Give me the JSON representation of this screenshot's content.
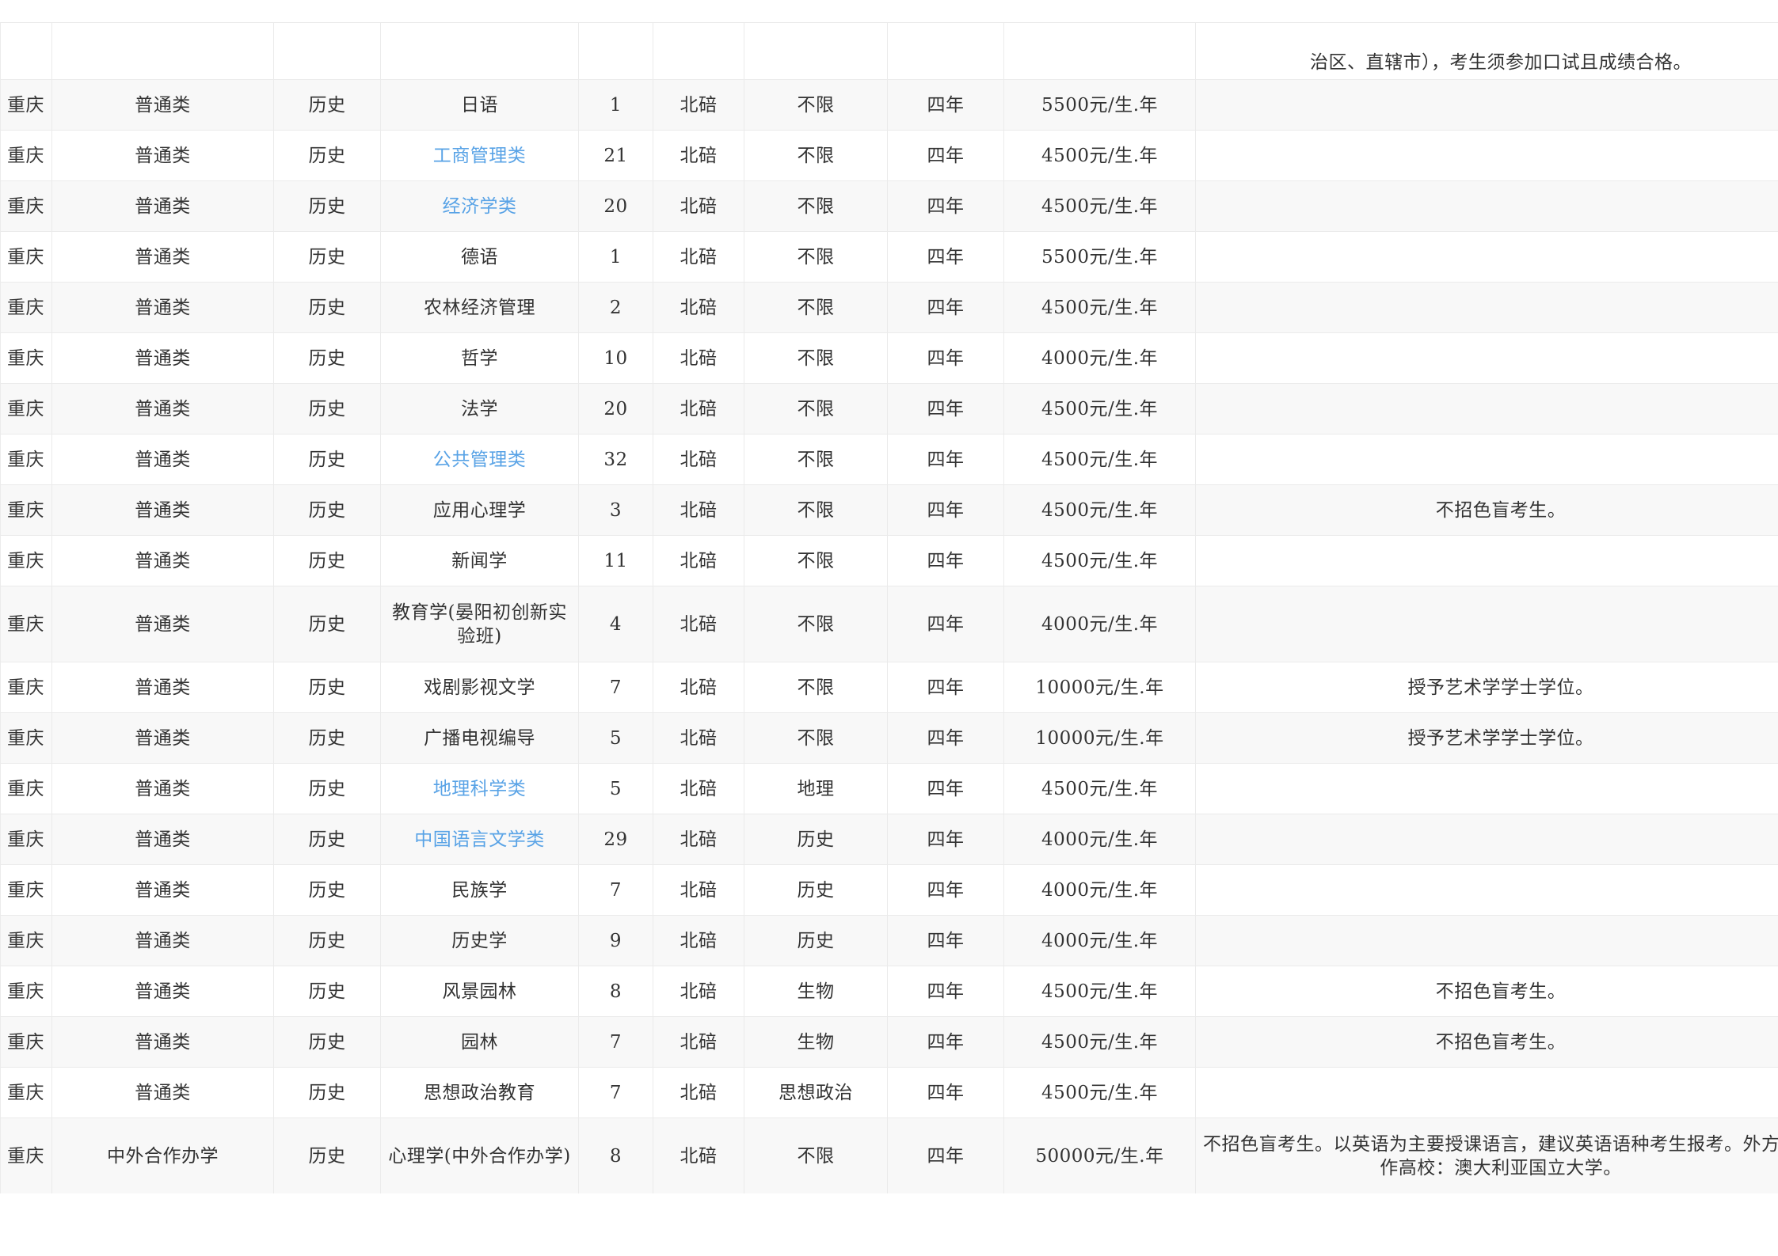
{
  "table": {
    "first_row_note": "治区、直辖市），考生须参加口试且成绩合格。",
    "rows": [
      {
        "province": "重庆",
        "type": "普通类",
        "subject": "历史",
        "major": "日语",
        "is_link": false,
        "count": "1",
        "campus": "北碚",
        "req": "不限",
        "years": "四年",
        "fee": "5500元/生.年",
        "note": ""
      },
      {
        "province": "重庆",
        "type": "普通类",
        "subject": "历史",
        "major": "工商管理类",
        "is_link": true,
        "count": "21",
        "campus": "北碚",
        "req": "不限",
        "years": "四年",
        "fee": "4500元/生.年",
        "note": ""
      },
      {
        "province": "重庆",
        "type": "普通类",
        "subject": "历史",
        "major": "经济学类",
        "is_link": true,
        "count": "20",
        "campus": "北碚",
        "req": "不限",
        "years": "四年",
        "fee": "4500元/生.年",
        "note": ""
      },
      {
        "province": "重庆",
        "type": "普通类",
        "subject": "历史",
        "major": "德语",
        "is_link": false,
        "count": "1",
        "campus": "北碚",
        "req": "不限",
        "years": "四年",
        "fee": "5500元/生.年",
        "note": ""
      },
      {
        "province": "重庆",
        "type": "普通类",
        "subject": "历史",
        "major": "农林经济管理",
        "is_link": false,
        "count": "2",
        "campus": "北碚",
        "req": "不限",
        "years": "四年",
        "fee": "4500元/生.年",
        "note": ""
      },
      {
        "province": "重庆",
        "type": "普通类",
        "subject": "历史",
        "major": "哲学",
        "is_link": false,
        "count": "10",
        "campus": "北碚",
        "req": "不限",
        "years": "四年",
        "fee": "4000元/生.年",
        "note": ""
      },
      {
        "province": "重庆",
        "type": "普通类",
        "subject": "历史",
        "major": "法学",
        "is_link": false,
        "count": "20",
        "campus": "北碚",
        "req": "不限",
        "years": "四年",
        "fee": "4500元/生.年",
        "note": ""
      },
      {
        "province": "重庆",
        "type": "普通类",
        "subject": "历史",
        "major": "公共管理类",
        "is_link": true,
        "count": "32",
        "campus": "北碚",
        "req": "不限",
        "years": "四年",
        "fee": "4500元/生.年",
        "note": ""
      },
      {
        "province": "重庆",
        "type": "普通类",
        "subject": "历史",
        "major": "应用心理学",
        "is_link": false,
        "count": "3",
        "campus": "北碚",
        "req": "不限",
        "years": "四年",
        "fee": "4500元/生.年",
        "note": "不招色盲考生。"
      },
      {
        "province": "重庆",
        "type": "普通类",
        "subject": "历史",
        "major": "新闻学",
        "is_link": false,
        "count": "11",
        "campus": "北碚",
        "req": "不限",
        "years": "四年",
        "fee": "4500元/生.年",
        "note": ""
      },
      {
        "province": "重庆",
        "type": "普通类",
        "subject": "历史",
        "major": "教育学(晏阳初创新实验班)",
        "is_link": false,
        "count": "4",
        "campus": "北碚",
        "req": "不限",
        "years": "四年",
        "fee": "4000元/生.年",
        "note": ""
      },
      {
        "province": "重庆",
        "type": "普通类",
        "subject": "历史",
        "major": "戏剧影视文学",
        "is_link": false,
        "count": "7",
        "campus": "北碚",
        "req": "不限",
        "years": "四年",
        "fee": "10000元/生.年",
        "note": "授予艺术学学士学位。"
      },
      {
        "province": "重庆",
        "type": "普通类",
        "subject": "历史",
        "major": "广播电视编导",
        "is_link": false,
        "count": "5",
        "campus": "北碚",
        "req": "不限",
        "years": "四年",
        "fee": "10000元/生.年",
        "note": "授予艺术学学士学位。"
      },
      {
        "province": "重庆",
        "type": "普通类",
        "subject": "历史",
        "major": "地理科学类",
        "is_link": true,
        "count": "5",
        "campus": "北碚",
        "req": "地理",
        "years": "四年",
        "fee": "4500元/生.年",
        "note": ""
      },
      {
        "province": "重庆",
        "type": "普通类",
        "subject": "历史",
        "major": "中国语言文学类",
        "is_link": true,
        "count": "29",
        "campus": "北碚",
        "req": "历史",
        "years": "四年",
        "fee": "4000元/生.年",
        "note": ""
      },
      {
        "province": "重庆",
        "type": "普通类",
        "subject": "历史",
        "major": "民族学",
        "is_link": false,
        "count": "7",
        "campus": "北碚",
        "req": "历史",
        "years": "四年",
        "fee": "4000元/生.年",
        "note": ""
      },
      {
        "province": "重庆",
        "type": "普通类",
        "subject": "历史",
        "major": "历史学",
        "is_link": false,
        "count": "9",
        "campus": "北碚",
        "req": "历史",
        "years": "四年",
        "fee": "4000元/生.年",
        "note": ""
      },
      {
        "province": "重庆",
        "type": "普通类",
        "subject": "历史",
        "major": "风景园林",
        "is_link": false,
        "count": "8",
        "campus": "北碚",
        "req": "生物",
        "years": "四年",
        "fee": "4500元/生.年",
        "note": "不招色盲考生。"
      },
      {
        "province": "重庆",
        "type": "普通类",
        "subject": "历史",
        "major": "园林",
        "is_link": false,
        "count": "7",
        "campus": "北碚",
        "req": "生物",
        "years": "四年",
        "fee": "4500元/生.年",
        "note": "不招色盲考生。"
      },
      {
        "province": "重庆",
        "type": "普通类",
        "subject": "历史",
        "major": "思想政治教育",
        "is_link": false,
        "count": "7",
        "campus": "北碚",
        "req": "思想政治",
        "years": "四年",
        "fee": "4500元/生.年",
        "note": ""
      },
      {
        "province": "重庆",
        "type": "中外合作办学",
        "subject": "历史",
        "major": "心理学(中外合作办学)",
        "is_link": false,
        "count": "8",
        "campus": "北碚",
        "req": "不限",
        "years": "四年",
        "fee": "50000元/生.年",
        "note": "不招色盲考生。以英语为主要授课语言，建议英语语种考生报考。外方合作高校：澳大利亚国立大学。"
      }
    ]
  },
  "colors": {
    "link": "#59a3e6",
    "text": "#333333",
    "border": "#ebebeb",
    "stripe": "#f8f8f8"
  }
}
